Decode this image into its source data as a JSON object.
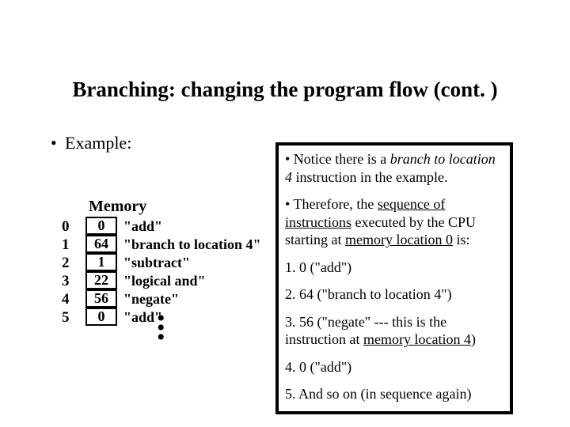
{
  "title": "Branching: changing the program flow (cont. )",
  "example_label": "Example:",
  "memory": {
    "header": "Memory",
    "rows": [
      {
        "addr": "0",
        "val": "0",
        "instr": "\"add\""
      },
      {
        "addr": "1",
        "val": "64",
        "instr": "\"branch to location 4\""
      },
      {
        "addr": "2",
        "val": "1",
        "instr": "\"subtract\""
      },
      {
        "addr": "3",
        "val": "22",
        "instr": "\"logical and\""
      },
      {
        "addr": "4",
        "val": "56",
        "instr": "\"negate\""
      },
      {
        "addr": "5",
        "val": "0",
        "instr": "\"add\""
      }
    ]
  },
  "callout": {
    "p1_pre": "• Notice there is a ",
    "p1_em": "branch to location 4",
    "p1_post": " instruction in the example.",
    "p2_pre": "• Therefore, the ",
    "p2_u1": "sequence of instructions",
    "p2_mid": " executed by the CPU starting at ",
    "p2_u2": "memory location 0",
    "p2_post": " is:",
    "s1": "1. 0 (\"add\")",
    "s2": "2. 64 (\"branch to location 4\")",
    "s3_pre": "3. 56 (\"negate\" --- this is the instruction at ",
    "s3_u": "memory location 4",
    "s3_post": ")",
    "s4": "4. 0 (\"add\")",
    "s5": "5. And so on (in sequence again)"
  }
}
